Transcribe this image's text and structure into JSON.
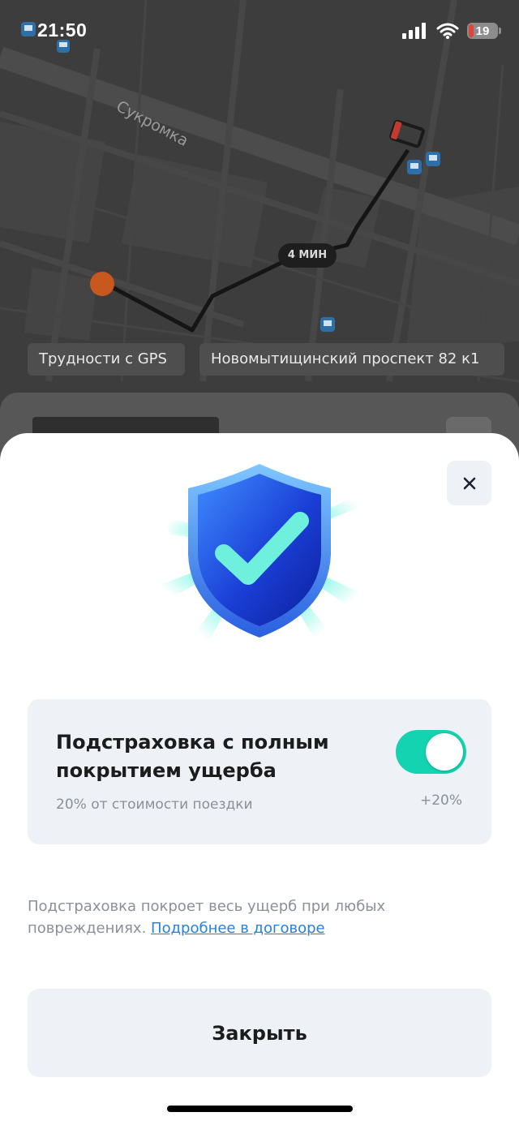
{
  "status_bar": {
    "time": "21:50",
    "battery": "19",
    "battery_level": 0.19,
    "icons": [
      "signal-icon",
      "wifi-icon",
      "battery-icon"
    ]
  },
  "map": {
    "street_label": "Сукромка",
    "eta": "4 МИН",
    "chips": {
      "gps": "Трудности с GPS",
      "address": "Новомытищинский проспект 82 к1"
    },
    "icons": [
      "bus-stop-icon",
      "car-marker-icon",
      "user-location-icon"
    ]
  },
  "sheet": {
    "hero_icon": "shield-check-icon",
    "option": {
      "title": "Подстраховка с полным покрытием ущерба",
      "subtitle": "20% от стоимости поездки",
      "price": "+20%",
      "enabled": true
    },
    "note": {
      "text": "Подстраховка покроет весь ущерб при любых повреждениях.",
      "link": "Подробнее в договоре"
    },
    "close_label": "Закрыть"
  },
  "colors": {
    "accent": "#14d3b1",
    "link": "#2b7fd8",
    "card_bg": "#eef1f5",
    "muted_text": "#8a9099"
  }
}
